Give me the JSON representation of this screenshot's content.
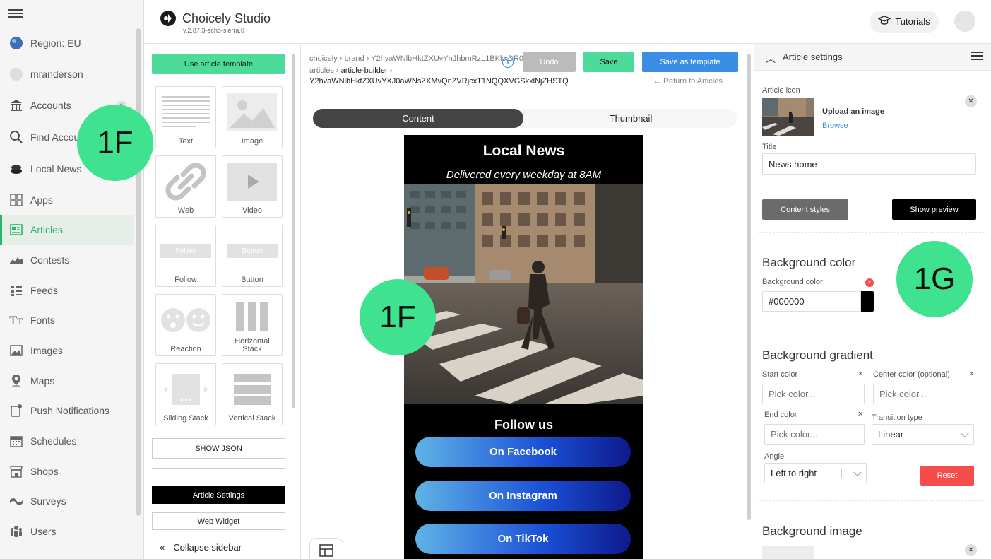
{
  "app": {
    "name": "Choicely Studio",
    "version": "v.2.87.3-echo-sierra.0",
    "tutorials_label": "Tutorials"
  },
  "leftnav": {
    "items": [
      {
        "label": "Region: EU",
        "icon": "globe-icon"
      },
      {
        "label": "mranderson",
        "icon": "user-avatar-icon"
      },
      {
        "label": "Accounts",
        "icon": "bank-icon"
      },
      {
        "label": "Find Accounts",
        "icon": "search-icon"
      },
      {
        "label": "Local News",
        "icon": "app-stack-icon"
      },
      {
        "label": "Apps",
        "icon": "apps-grid-icon"
      },
      {
        "label": "Articles",
        "icon": "articles-icon"
      },
      {
        "label": "Contests",
        "icon": "contests-icon"
      },
      {
        "label": "Feeds",
        "icon": "feeds-icon"
      },
      {
        "label": "Fonts",
        "icon": "fonts-icon"
      },
      {
        "label": "Images",
        "icon": "images-icon"
      },
      {
        "label": "Maps",
        "icon": "map-pin-icon"
      },
      {
        "label": "Push Notifications",
        "icon": "push-notification-icon"
      },
      {
        "label": "Schedules",
        "icon": "calendar-icon"
      },
      {
        "label": "Shops",
        "icon": "shop-icon"
      },
      {
        "label": "Surveys",
        "icon": "surveys-icon"
      },
      {
        "label": "Users",
        "icon": "users-icon"
      }
    ],
    "accounts_badge": "1",
    "active_item": "Articles"
  },
  "widgets": {
    "template_button": "Use article template",
    "tiles": [
      {
        "label": "Text"
      },
      {
        "label": "Image"
      },
      {
        "label": "Web"
      },
      {
        "label": "Video"
      },
      {
        "label": "Follow",
        "preview": "Follow"
      },
      {
        "label": "Button",
        "preview": "Button"
      },
      {
        "label": "Reaction"
      },
      {
        "label": "Horizontal Stack"
      },
      {
        "label": "Sliding Stack"
      },
      {
        "label": "Vertical Stack"
      }
    ],
    "show_json": "SHOW JSON",
    "article_settings": "Article Settings",
    "web_widget": "Web Widget",
    "collapse_sidebar": "Collapse sidebar"
  },
  "center": {
    "breadcrumb_1": "choicely › brand › Y2hvaWNlbHktZXUvYnJhbmRzL1BKkxDR0lpakJvd...",
    "breadcrumb_2_a": "articles › ",
    "breadcrumb_2_b": "article-builder",
    "breadcrumb_2_c": " ›",
    "article_id": "Y2hvaWNlbHktZXUvYXJ0aWNsZXMvQnZVRjcxT1NQQXVGSkxlNjZHSTQ",
    "undo_label": "Undo",
    "save_label": "Save",
    "save_template_label": "Save as template",
    "return_label": "← Return to Articles",
    "tabs": [
      {
        "label": "Content"
      },
      {
        "label": "Thumbnail"
      }
    ],
    "preview": {
      "title": "Local News",
      "subtitle": "Delivered every weekday at 8AM",
      "follow_title": "Follow us",
      "buttons": [
        "On Facebook",
        "On Instagram",
        "On TikTok"
      ]
    }
  },
  "settings": {
    "header": "Article settings",
    "article_icon_label": "Article icon",
    "upload_label": "Upload an image",
    "browse_label": "Browse",
    "title_label": "Title",
    "title_value": "News home",
    "content_styles_label": "Content styles",
    "show_preview_label": "Show preview",
    "bg_color_section": "Background color",
    "bg_color_label": "Background color",
    "bg_color_value": "#000000",
    "bg_gradient_section": "Background gradient",
    "start_color_label": "Start color",
    "center_color_label": "Center color (optional)",
    "end_color_label": "End color",
    "transition_label": "Transition type",
    "pick_color_placeholder": "Pick color...",
    "transition_value": "Linear",
    "angle_label": "Angle",
    "angle_value": "Left to right",
    "reset_label": "Reset",
    "bg_image_section": "Background image"
  },
  "markers": [
    "1F",
    "1F",
    "1G"
  ],
  "colors": {
    "accent_green": "#4ddb9a",
    "marker_green": "#3fe28f",
    "primary_blue": "#3a8ee6",
    "danger_red": "#f54c4c"
  }
}
